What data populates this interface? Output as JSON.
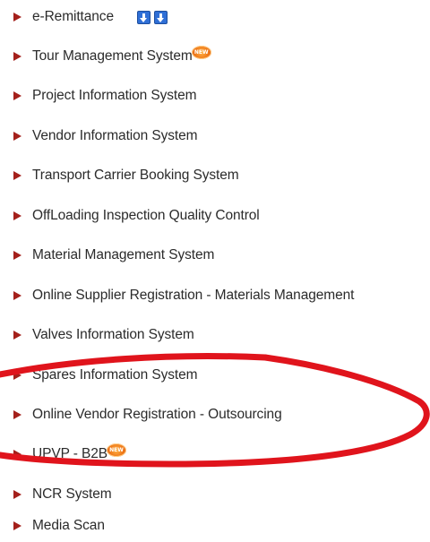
{
  "menu": {
    "items": [
      {
        "label": "e-Remittance",
        "badge": null,
        "download_icons": 2
      },
      {
        "label": "Tour Management System",
        "badge": "NEW"
      },
      {
        "label": "Project Information System",
        "badge": null
      },
      {
        "label": "Vendor Information System",
        "badge": null
      },
      {
        "label": "Transport Carrier Booking System",
        "badge": null
      },
      {
        "label": "OffLoading Inspection Quality Control",
        "badge": null
      },
      {
        "label": "Material Management System",
        "badge": null
      },
      {
        "label": "Online Supplier Registration - Materials Management",
        "badge": null
      },
      {
        "label": "Valves Information System",
        "badge": null
      },
      {
        "label": "Spares Information System",
        "badge": null
      },
      {
        "label": "Online Vendor Registration - Outsourcing",
        "badge": null,
        "highlighted": true
      },
      {
        "label": "UPVP - B2B",
        "badge": "NEW"
      },
      {
        "label": "NCR System",
        "badge": null
      },
      {
        "label": "Media Scan",
        "badge": null
      }
    ],
    "bullet_color": "#a4201b",
    "text_color": "#2b2b2b",
    "download_icon_color": "#2f6fd6",
    "badge_color": "#f07a1a",
    "highlight_color": "#e0141c"
  },
  "icons": {
    "bullet": "triangle-right-icon",
    "download": "download-arrow-icon",
    "new_badge": "new-badge-icon"
  }
}
